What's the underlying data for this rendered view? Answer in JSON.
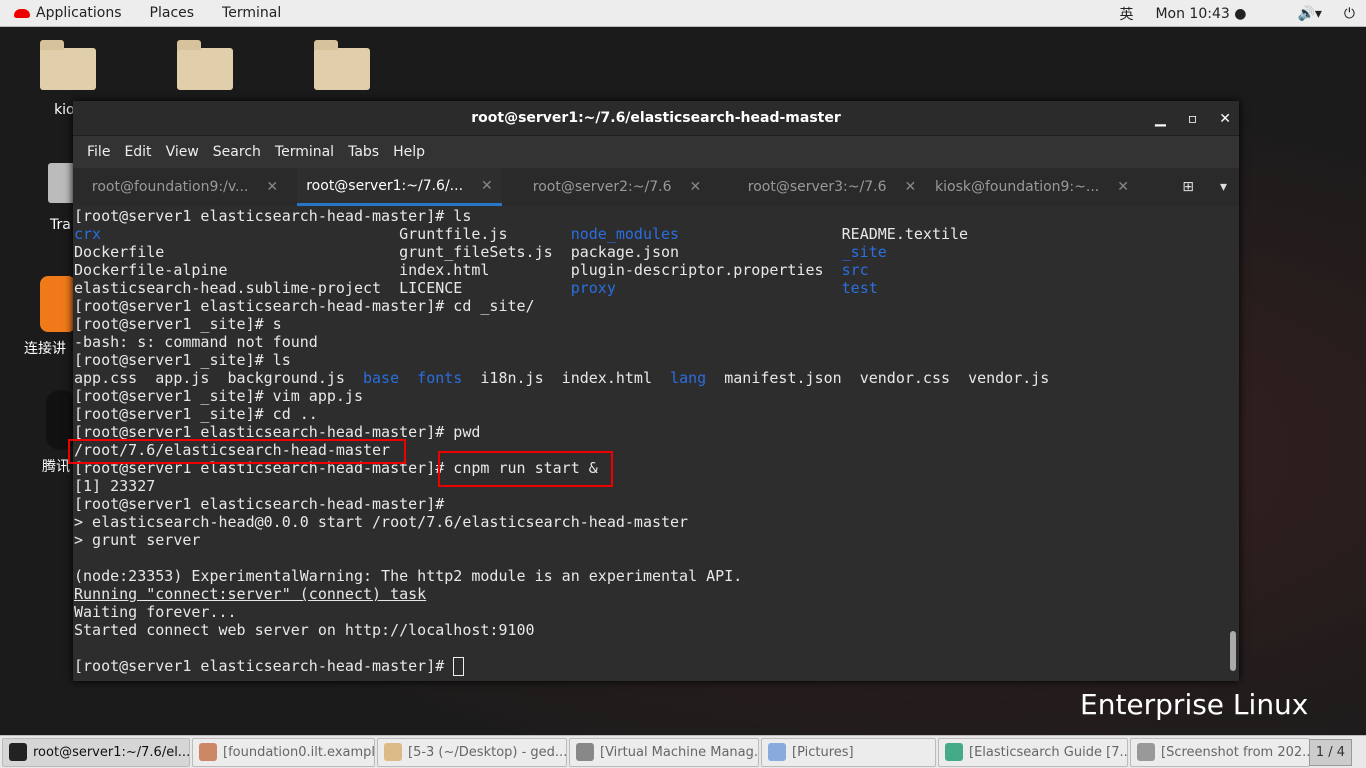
{
  "topbar": {
    "applications": "Applications",
    "places": "Places",
    "terminal": "Terminal",
    "input_method": "英",
    "clock": "Mon 10:43 ●",
    "volume_icon": "speaker-icon",
    "power_icon": "power-icon"
  },
  "desktop": {
    "icons": [
      {
        "label": "kios"
      },
      {
        "label": ""
      },
      {
        "label": ""
      },
      {
        "label": "Tra"
      },
      {
        "label": "连接讲"
      },
      {
        "label": "腾讯"
      }
    ],
    "brand": "Enterprise Linux"
  },
  "terminal": {
    "title": "root@server1:~/7.6/elasticsearch-head-master",
    "menu": [
      "File",
      "Edit",
      "View",
      "Search",
      "Terminal",
      "Tabs",
      "Help"
    ],
    "tabs": [
      {
        "label": "root@foundation9:/v..."
      },
      {
        "label": "root@server1:~/7.6/..."
      },
      {
        "label": "root@server2:~/7.6"
      },
      {
        "label": "root@server3:~/7.6"
      },
      {
        "label": "kiosk@foundation9:~..."
      }
    ],
    "active_tab": 1,
    "lines": [
      [
        {
          "t": "[root@server1 elasticsearch-head-master]# ls"
        }
      ],
      [
        {
          "t": "crx",
          "c": "blue"
        },
        {
          "t": "                                 Gruntfile.js       "
        },
        {
          "t": "node_modules",
          "c": "blue"
        },
        {
          "t": "                  README.textile"
        }
      ],
      [
        {
          "t": "Dockerfile                          grunt_fileSets.js  package.json                  "
        },
        {
          "t": "_site",
          "c": "blue"
        }
      ],
      [
        {
          "t": "Dockerfile-alpine                   index.html         plugin-descriptor.properties  "
        },
        {
          "t": "src",
          "c": "blue"
        }
      ],
      [
        {
          "t": "elasticsearch-head.sublime-project  LICENCE            "
        },
        {
          "t": "proxy",
          "c": "blue"
        },
        {
          "t": "                         "
        },
        {
          "t": "test",
          "c": "blue"
        }
      ],
      [
        {
          "t": "[root@server1 elasticsearch-head-master]# cd _site/"
        }
      ],
      [
        {
          "t": "[root@server1 _site]# s"
        }
      ],
      [
        {
          "t": "-bash: s: command not found"
        }
      ],
      [
        {
          "t": "[root@server1 _site]# ls"
        }
      ],
      [
        {
          "t": "app.css  app.js  background.js  "
        },
        {
          "t": "base",
          "c": "blue"
        },
        {
          "t": "  "
        },
        {
          "t": "fonts",
          "c": "blue"
        },
        {
          "t": "  i18n.js  index.html  "
        },
        {
          "t": "lang",
          "c": "blue"
        },
        {
          "t": "  manifest.json  vendor.css  vendor.js"
        }
      ],
      [
        {
          "t": "[root@server1 _site]# vim app.js"
        }
      ],
      [
        {
          "t": "[root@server1 _site]# cd .."
        }
      ],
      [
        {
          "t": "[root@server1 elasticsearch-head-master]# pwd"
        }
      ],
      [
        {
          "t": "/root/7.6/elasticsearch-head-master"
        }
      ],
      [
        {
          "t": "[root@server1 elasticsearch-head-master]# cnpm run start &"
        }
      ],
      [
        {
          "t": "[1] 23327"
        }
      ],
      [
        {
          "t": "[root@server1 elasticsearch-head-master]# "
        }
      ],
      [
        {
          "t": "> elasticsearch-head@0.0.0 start /root/7.6/elasticsearch-head-master"
        }
      ],
      [
        {
          "t": "> grunt server"
        }
      ],
      [
        {
          "t": ""
        }
      ],
      [
        {
          "t": "(node:23353) ExperimentalWarning: The http2 module is an experimental API."
        }
      ],
      [
        {
          "t": "Running \"connect:server\" (connect) task",
          "c": "ul"
        }
      ],
      [
        {
          "t": "Waiting forever..."
        }
      ],
      [
        {
          "t": "Started connect web server on http://localhost:9100"
        }
      ],
      [
        {
          "t": ""
        }
      ],
      [
        {
          "t": "[root@server1 elasticsearch-head-master]# "
        }
      ]
    ]
  },
  "taskbar": {
    "items": [
      {
        "label": "root@server1:~/7.6/el...",
        "color": "#222"
      },
      {
        "label": "[foundation0.ilt.exampl...",
        "color": "#c86"
      },
      {
        "label": "[5-3 (~/Desktop) - ged...",
        "color": "#db8"
      },
      {
        "label": "[Virtual Machine Manag...",
        "color": "#888"
      },
      {
        "label": "[Pictures]",
        "color": "#8ad"
      },
      {
        "label": "[Elasticsearch Guide [7...",
        "color": "#4a8"
      },
      {
        "label": "[Screenshot from 202...",
        "color": "#999"
      }
    ],
    "pager": "1 / 4"
  }
}
